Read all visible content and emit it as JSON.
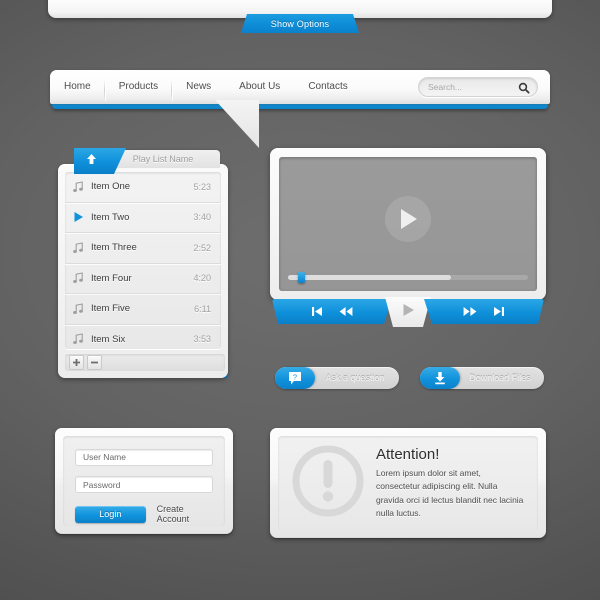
{
  "top": {
    "show_options_label": "Show Options"
  },
  "nav": {
    "items": [
      {
        "label": "Home"
      },
      {
        "label": "Products"
      },
      {
        "label": "News"
      },
      {
        "label": "About Us"
      },
      {
        "label": "Contacts"
      }
    ],
    "search_placeholder": "Search...",
    "search_value": "",
    "search_icon": "search-icon",
    "accent_color": "#1192dc"
  },
  "playlist": {
    "header_label": "Play List Name",
    "collapse_icon": "arrow-up-icon",
    "expand_icon": "arrow-down-icon",
    "add_icon": "plus-icon",
    "remove_icon": "minus-icon",
    "rows": [
      {
        "icon": "music-note-icon",
        "title": "Item One",
        "time": "5:23",
        "playing": false
      },
      {
        "icon": "play-icon",
        "title": "Item Two",
        "time": "3:40",
        "playing": true
      },
      {
        "icon": "music-note-icon",
        "title": "Item Three",
        "time": "2:52",
        "playing": false
      },
      {
        "icon": "music-note-icon",
        "title": "Item Four",
        "time": "4:20",
        "playing": false
      },
      {
        "icon": "music-note-icon",
        "title": "Item Five",
        "time": "6:11",
        "playing": false
      },
      {
        "icon": "music-note-icon",
        "title": "Item Six",
        "time": "3:53",
        "playing": false
      }
    ]
  },
  "player": {
    "big_play_icon": "play-circle-icon",
    "progress_percent": 4,
    "buffered_percent": 68,
    "controls": {
      "previous_icon": "skip-previous-icon",
      "rewind_icon": "rewind-icon",
      "play_icon": "play-icon",
      "forward_icon": "fast-forward-icon",
      "next_icon": "skip-next-icon"
    }
  },
  "actions": [
    {
      "label": "Ask a question",
      "icon": "question-bubble-icon"
    },
    {
      "label": "Download Files",
      "icon": "download-icon"
    }
  ],
  "login": {
    "username_placeholder": "User Name",
    "username_value": "",
    "password_placeholder": "Password",
    "password_value": "",
    "login_label": "Login",
    "create_account_label": "Create Account"
  },
  "attention": {
    "icon": "exclamation-circle-icon",
    "title": "Attention!",
    "text": "Lorem ipsum dolor sit amet, consectetur adipiscing elit. Nulla gravida orci id lectus blandit nec lacinia nulla luctus."
  }
}
